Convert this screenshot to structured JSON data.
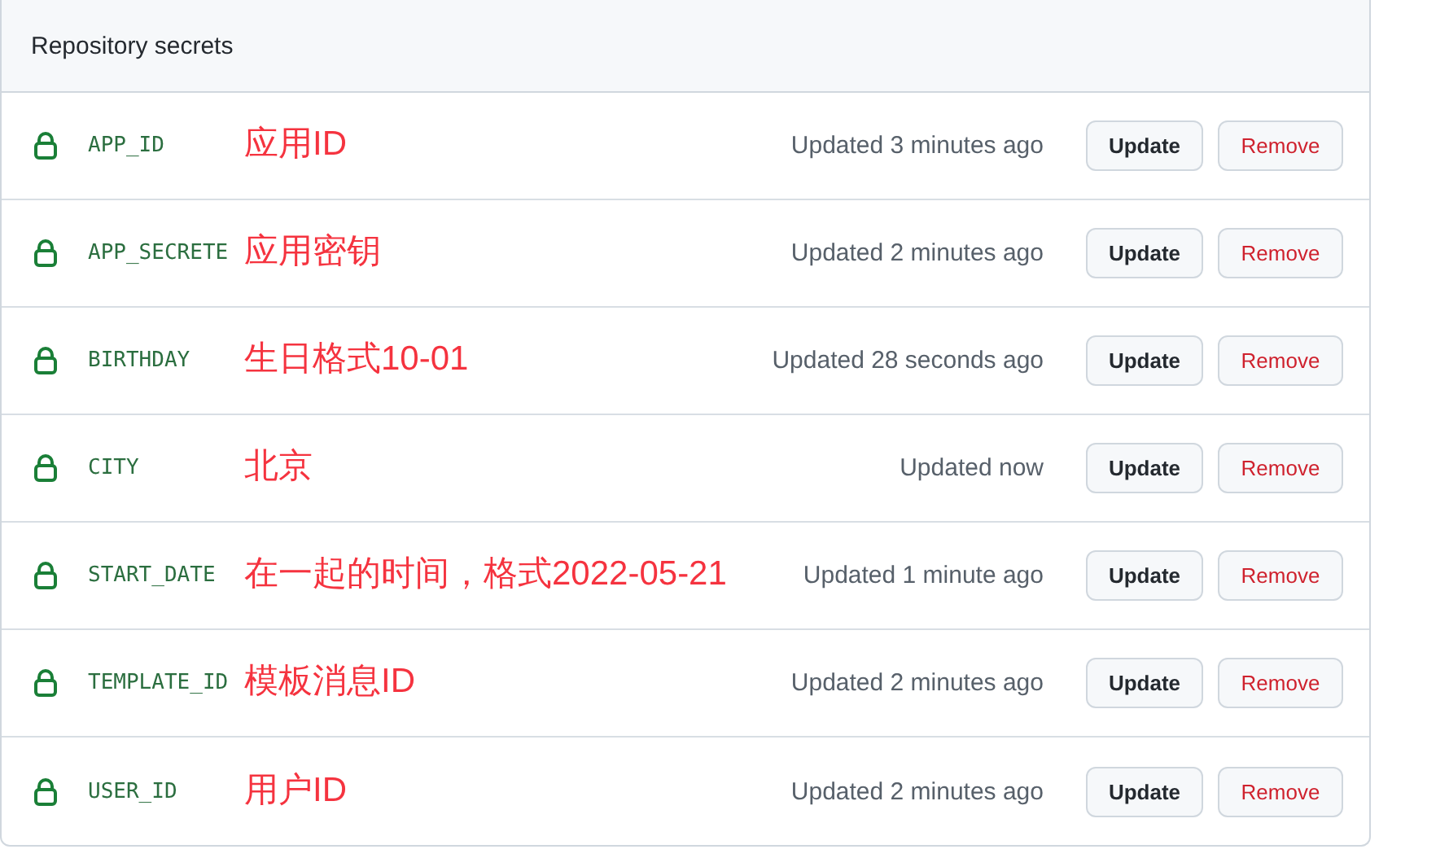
{
  "panel": {
    "title": "Repository secrets"
  },
  "secrets": [
    {
      "name": "APP_ID",
      "annotation": "应用ID",
      "updated": "Updated 3 minutes ago",
      "buttons": [
        "Update",
        "Remove"
      ]
    },
    {
      "name": "APP_SECRETE",
      "annotation": "应用密钥",
      "updated": "Updated 2 minutes ago",
      "buttons": [
        "Update",
        "Remove"
      ]
    },
    {
      "name": "BIRTHDAY",
      "annotation": "生日格式10-01",
      "updated": "Updated 28 seconds ago",
      "buttons": [
        "Update",
        "Remove"
      ]
    },
    {
      "name": "CITY",
      "annotation": "北京",
      "updated": "Updated now",
      "buttons": [
        "Update",
        "Remove"
      ]
    },
    {
      "name": "START_DATE",
      "annotation": "在一起的时间，格式2022-05-21",
      "updated": "Updated 1 minute ago",
      "buttons": [
        "Update",
        "Remove"
      ]
    },
    {
      "name": "TEMPLATE_ID",
      "annotation": "模板消息ID",
      "updated": "Updated 2 minutes ago",
      "buttons": [
        "Update",
        "Remove"
      ]
    },
    {
      "name": "USER_ID",
      "annotation": "用户ID",
      "updated": "Updated 2 minutes ago",
      "buttons": [
        "Update",
        "Remove"
      ]
    }
  ]
}
